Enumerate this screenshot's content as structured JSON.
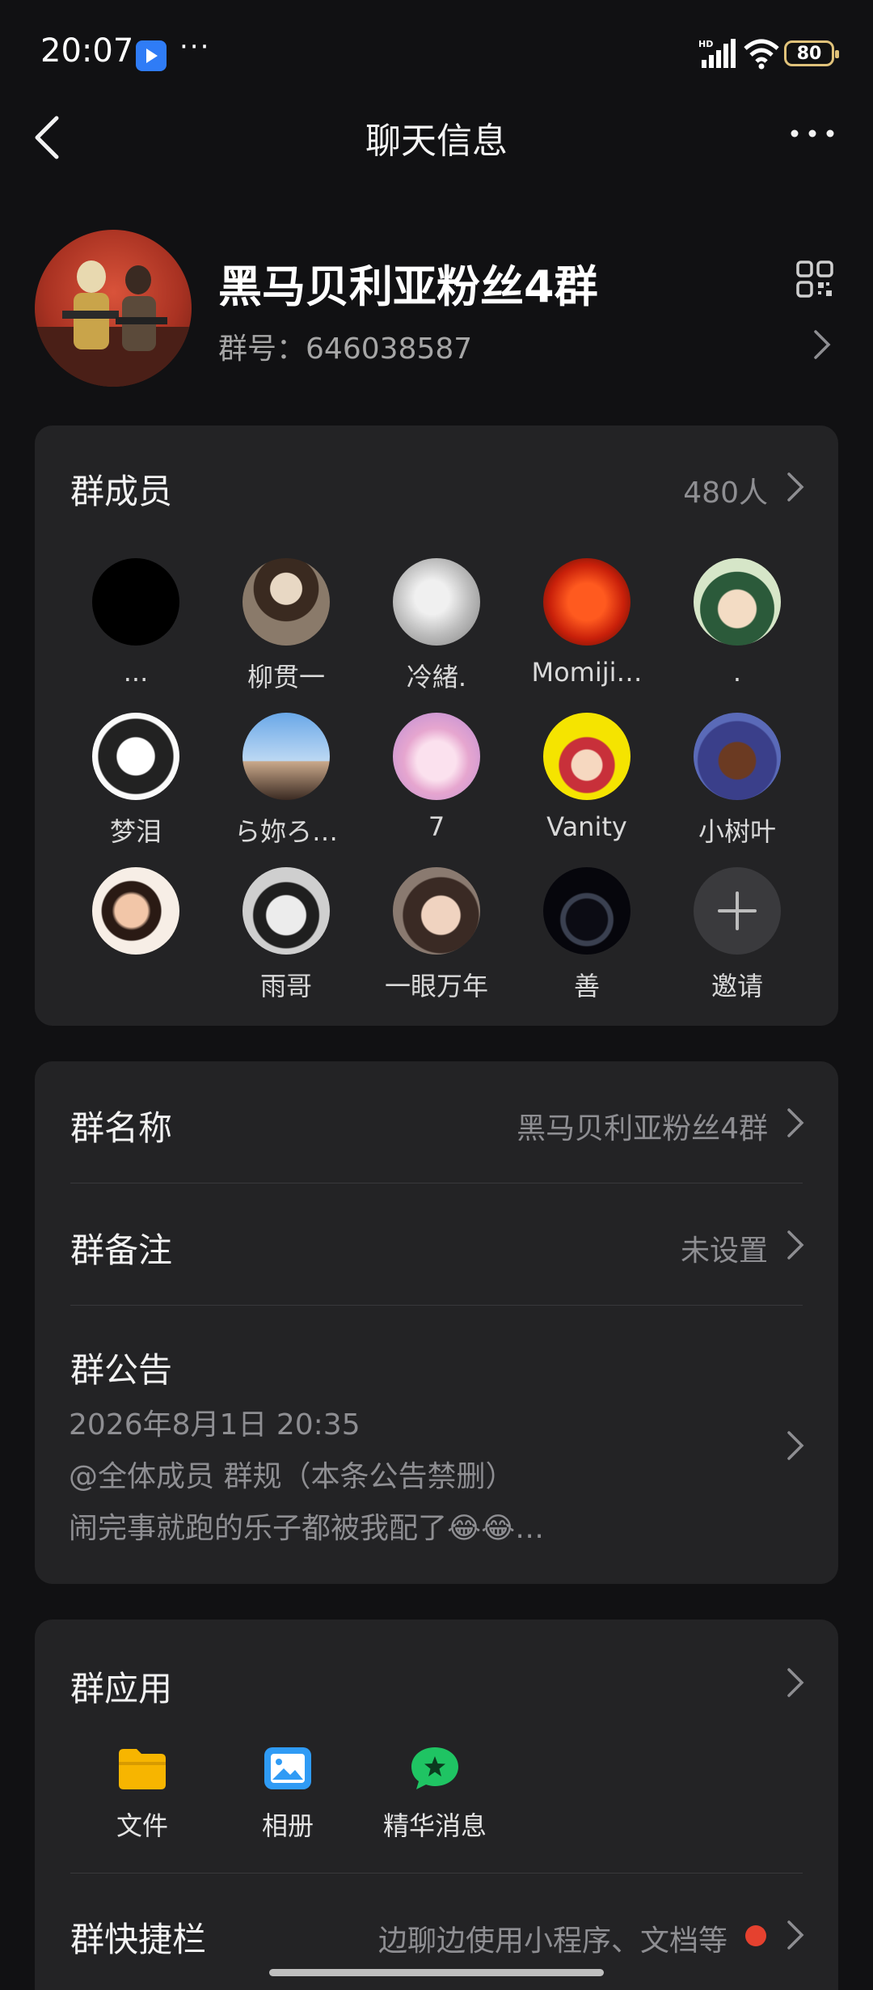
{
  "status_bar": {
    "time": "20:07",
    "dots": "···",
    "battery": "80"
  },
  "header": {
    "title": "聊天信息"
  },
  "group": {
    "name": "黑马贝利亚粉丝4群",
    "id_label": "群号：",
    "id": "646038587"
  },
  "members": {
    "title": "群成员",
    "count": "480人",
    "list": [
      {
        "name": "..."
      },
      {
        "name": "柳贯一"
      },
      {
        "name": "冷緒."
      },
      {
        "name": "Momiji…"
      },
      {
        "name": "."
      },
      {
        "name": "梦泪"
      },
      {
        "name": "ら妳ろ…"
      },
      {
        "name": "7"
      },
      {
        "name": "Vanity"
      },
      {
        "name": "小树叶"
      },
      {
        "name": ""
      },
      {
        "name": "雨哥"
      },
      {
        "name": "一眼万年"
      },
      {
        "name": "善"
      }
    ],
    "invite_label": "邀请"
  },
  "settings": {
    "group_name_label": "群名称",
    "group_name_value": "黑马贝利亚粉丝4群",
    "group_remark_label": "群备注",
    "group_remark_value": "未设置",
    "notice_label": "群公告",
    "notice_date": "2026年8月1日 20:35",
    "notice_line1": "@全体成员 群规（本条公告禁删）",
    "notice_line2": "闹完事就跑的乐子都被我配了😂😂…"
  },
  "apps": {
    "title": "群应用",
    "items": [
      {
        "label": "文件",
        "icon": "folder-icon",
        "color": "#f7b500"
      },
      {
        "label": "相册",
        "icon": "photo-album-icon",
        "color": "#2f9bf5"
      },
      {
        "label": "精华消息",
        "icon": "star-bubble-icon",
        "color": "#1fc463"
      }
    ]
  },
  "shortcut": {
    "label": "群快捷栏",
    "value": "边聊边使用小程序、文档等"
  }
}
